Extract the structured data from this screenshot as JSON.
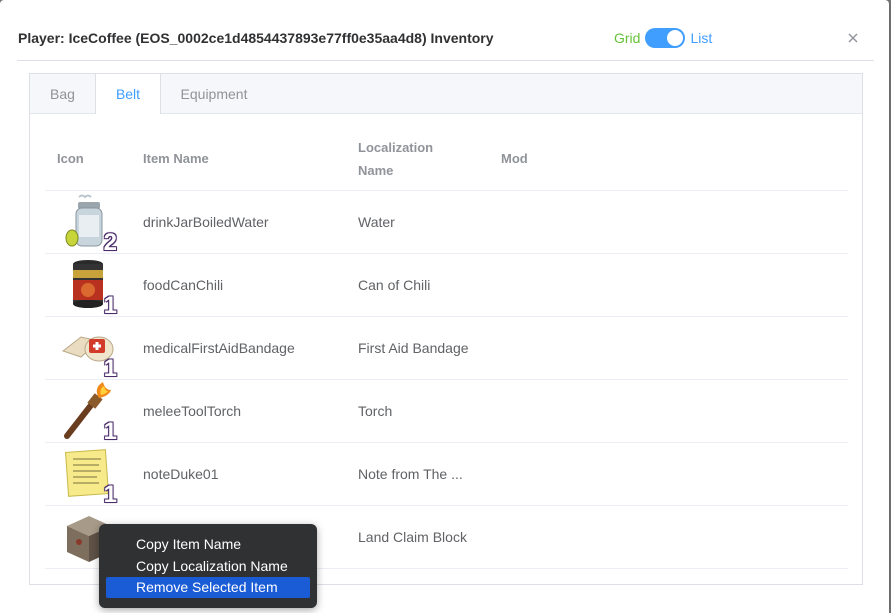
{
  "dialog": {
    "title": "Player: IceCoffee (EOS_0002ce1d4854437893e77ff0e35aa4d8) Inventory",
    "view_switch": {
      "left_label": "Grid",
      "right_label": "List",
      "state": "List"
    },
    "close_icon": "close-icon"
  },
  "tabs": [
    {
      "label": "Bag",
      "active": false
    },
    {
      "label": "Belt",
      "active": true
    },
    {
      "label": "Equipment",
      "active": false
    }
  ],
  "table": {
    "headers": {
      "icon": "Icon",
      "item_name": "Item Name",
      "localization_line1": "Localization",
      "localization_line2": "Name",
      "mod": "Mod"
    },
    "rows": [
      {
        "icon": "water-jar-icon",
        "count": "2",
        "item_name": "drinkJarBoiledWater",
        "localization": "Water",
        "mod": ""
      },
      {
        "icon": "chili-can-icon",
        "count": "1",
        "item_name": "foodCanChili",
        "localization": "Can of Chili",
        "mod": ""
      },
      {
        "icon": "bandage-icon",
        "count": "1",
        "item_name": "medicalFirstAidBandage",
        "localization": "First Aid Bandage",
        "mod": ""
      },
      {
        "icon": "torch-icon",
        "count": "1",
        "item_name": "meleeToolTorch",
        "localization": "Torch",
        "mod": ""
      },
      {
        "icon": "note-icon",
        "count": "1",
        "item_name": "noteDuke01",
        "localization": "Note from The ...",
        "mod": ""
      },
      {
        "icon": "land-claim-block-icon",
        "count": "",
        "item_name": "",
        "localization": "Land Claim Block",
        "mod": ""
      }
    ]
  },
  "context_menu": {
    "items": [
      {
        "label": "Copy Item Name",
        "selected": false
      },
      {
        "label": "Copy Localization Name",
        "selected": false
      },
      {
        "label": "Remove Selected Item",
        "selected": true
      }
    ]
  },
  "colors": {
    "accent": "#409eff",
    "grid_label": "#67c23a",
    "menu_bg": "#303133",
    "menu_selected": "#1a5bd6"
  }
}
